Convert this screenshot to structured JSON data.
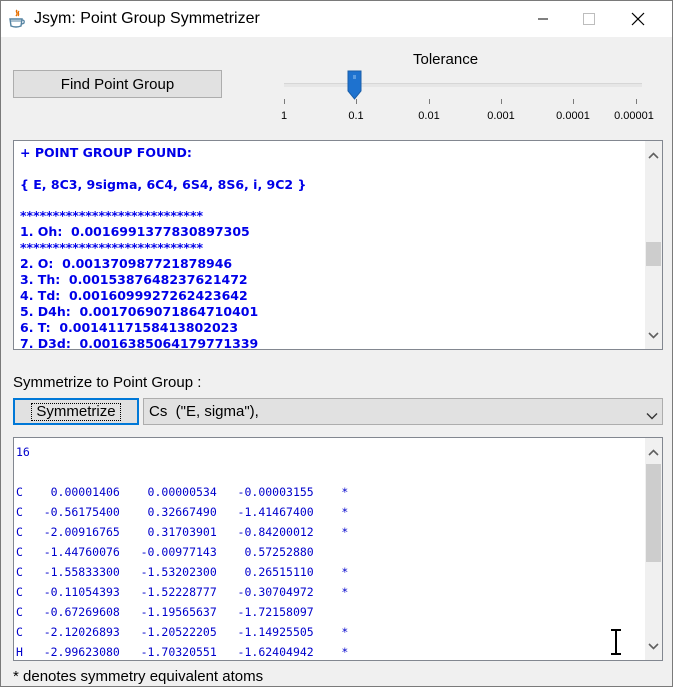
{
  "window": {
    "title": "Jsym: Point Group Symmetrizer",
    "controls": [
      "minimize",
      "maximize",
      "close"
    ],
    "app_icon": "java-coffee-icon"
  },
  "toolbar": {
    "find_button_label": "Find Point Group"
  },
  "tolerance": {
    "label": "Tolerance",
    "ticks": [
      "1",
      "0.1",
      "0.01",
      "0.001",
      "0.0001",
      "0.00001"
    ],
    "selected": "0.1"
  },
  "results": {
    "lines": [
      "+ POINT GROUP FOUND:",
      "",
      "{ E, 8C3, 9sigma, 6C4, 6S4, 8S6, i, 9C2 }",
      "",
      "****************************",
      "1. Oh:  0.0016991377830897305",
      "****************************",
      "2. O:  0.001370987721878946",
      "3. Th:  0.0015387648237621472",
      "4. Td:  0.0016099927262423642",
      "5. D4h:  0.0017069071864710401",
      "6. T:  0.0014117158413802023",
      "7. D3d:  0.0016385064179771339"
    ]
  },
  "symmetrize": {
    "label": "Symmetrize to Point Group :",
    "button_label": "Symmetrize",
    "selected_group": "Cs  (\"E, sigma\"),"
  },
  "coords": {
    "lines": [
      "16",
      "",
      "C    0.00001406    0.00000534   -0.00003155    *",
      "C   -0.56175400    0.32667490   -1.41467400    *",
      "C   -2.00916765    0.31703901   -0.84200012    *",
      "C   -1.44760076   -0.00977143    0.57252880",
      "C   -1.55833300   -1.53202300    0.26515110    *",
      "C   -0.11054393   -1.52228777   -0.30704972    *",
      "C   -0.67269608   -1.19565637   -1.72158097",
      "C   -2.12026893   -1.20522205   -1.14925505    *",
      "H   -2.99623080   -1.70320551   -1.62404942    *"
    ]
  },
  "footer": {
    "note": "* denotes symmetry equivalent atoms"
  },
  "colors": {
    "output_text": "#0000e8",
    "button_face": "#e1e1e1",
    "window_bg": "#f0f0f0",
    "slider_thumb": "#1e72cf"
  }
}
